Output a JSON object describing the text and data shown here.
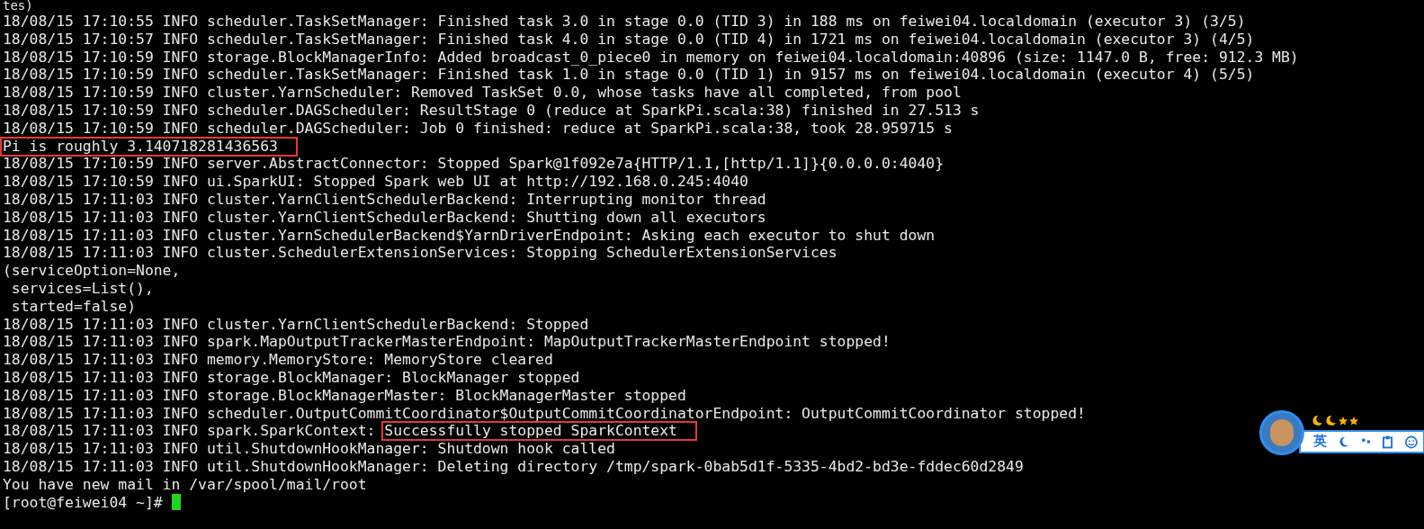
{
  "terminal": {
    "lines": [
      {
        "text": "tes)"
      },
      {
        "text": "18/08/15 17:10:55 INFO scheduler.TaskSetManager: Finished task 3.0 in stage 0.0 (TID 3) in 188 ms on feiwei04.localdomain (executor 3) (3/5)"
      },
      {
        "text": "18/08/15 17:10:57 INFO scheduler.TaskSetManager: Finished task 4.0 in stage 0.0 (TID 4) in 1721 ms on feiwei04.localdomain (executor 3) (4/5)"
      },
      {
        "text": "18/08/15 17:10:59 INFO storage.BlockManagerInfo: Added broadcast_0_piece0 in memory on feiwei04.localdomain:40896 (size: 1147.0 B, free: 912.3 MB)"
      },
      {
        "text": "18/08/15 17:10:59 INFO scheduler.TaskSetManager: Finished task 1.0 in stage 0.0 (TID 1) in 9157 ms on feiwei04.localdomain (executor 4) (5/5)"
      },
      {
        "text": "18/08/15 17:10:59 INFO cluster.YarnScheduler: Removed TaskSet 0.0, whose tasks have all completed, from pool"
      },
      {
        "text": "18/08/15 17:10:59 INFO scheduler.DAGScheduler: ResultStage 0 (reduce at SparkPi.scala:38) finished in 27.513 s"
      },
      {
        "text": "18/08/15 17:10:59 INFO scheduler.DAGScheduler: Job 0 finished: reduce at SparkPi.scala:38, took 28.959715 s"
      },
      {
        "boxed": "Pi is roughly 3.140718281436563"
      },
      {
        "text": "18/08/15 17:10:59 INFO server.AbstractConnector: Stopped Spark@1f092e7a{HTTP/1.1,[http/1.1]}{0.0.0.0:4040}"
      },
      {
        "text": "18/08/15 17:10:59 INFO ui.SparkUI: Stopped Spark web UI at http://192.168.0.245:4040"
      },
      {
        "text": "18/08/15 17:11:03 INFO cluster.YarnClientSchedulerBackend: Interrupting monitor thread"
      },
      {
        "text": "18/08/15 17:11:03 INFO cluster.YarnClientSchedulerBackend: Shutting down all executors"
      },
      {
        "text": "18/08/15 17:11:03 INFO cluster.YarnSchedulerBackend$YarnDriverEndpoint: Asking each executor to shut down"
      },
      {
        "text": "18/08/15 17:11:03 INFO cluster.SchedulerExtensionServices: Stopping SchedulerExtensionServices"
      },
      {
        "text": "(serviceOption=None,"
      },
      {
        "text": " services=List(),"
      },
      {
        "text": " started=false)"
      },
      {
        "text": "18/08/15 17:11:03 INFO cluster.YarnClientSchedulerBackend: Stopped"
      },
      {
        "text": "18/08/15 17:11:03 INFO spark.MapOutputTrackerMasterEndpoint: MapOutputTrackerMasterEndpoint stopped!"
      },
      {
        "text": "18/08/15 17:11:03 INFO memory.MemoryStore: MemoryStore cleared"
      },
      {
        "text": "18/08/15 17:11:03 INFO storage.BlockManager: BlockManager stopped"
      },
      {
        "text": "18/08/15 17:11:03 INFO storage.BlockManagerMaster: BlockManagerMaster stopped"
      },
      {
        "text": "18/08/15 17:11:03 INFO scheduler.OutputCommitCoordinator$OutputCommitCoordinatorEndpoint: OutputCommitCoordinator stopped!"
      },
      {
        "text": "18/08/15 17:11:03 INFO spark.SparkContext: ",
        "boxed": "Successfully stopped SparkContext"
      },
      {
        "text": "18/08/15 17:11:03 INFO util.ShutdownHookManager: Shutdown hook called"
      },
      {
        "text": "18/08/15 17:11:03 INFO util.ShutdownHookManager: Deleting directory /tmp/spark-0bab5d1f-5335-4bd2-bd3e-fddec60d2849"
      },
      {
        "text": "You have new mail in /var/spool/mail/root"
      }
    ],
    "prompt": {
      "text": "[root@feiwei04 ~]# ",
      "cursor": true
    }
  },
  "ime_toolbar": {
    "mode_label": "英"
  }
}
